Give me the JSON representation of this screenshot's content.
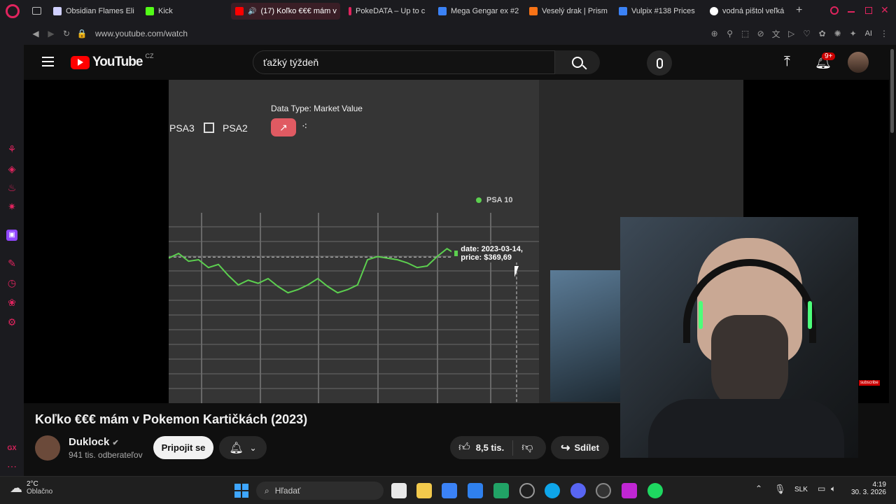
{
  "browser": {
    "tabs": [
      {
        "label": "Obsidian Flames Elit",
        "color": "#6a5acd"
      },
      {
        "label": "Kick",
        "color": "#53fc18"
      },
      {
        "label": "(17) Koľko €€€ mám v",
        "color": "#ff0000",
        "active": true
      },
      {
        "label": "PokeDATA – Up to c",
        "color": "#e0245e"
      },
      {
        "label": "Mega Gengar ex #2",
        "color": "#3b82f6"
      },
      {
        "label": "Veselý drak | Prism",
        "color": "#f97316"
      },
      {
        "label": "Vulpix #138 Prices",
        "color": "#3b82f6"
      },
      {
        "label": "vodná pištol veľká",
        "color": "#4285f4"
      }
    ],
    "url": "www.youtube.com/watch",
    "ai_label": "AI"
  },
  "youtube": {
    "logo_text": "YouTube",
    "logo_region": "CZ",
    "search_query": "ťažký týždeň",
    "notification_badge": "9+"
  },
  "chart_overlay": {
    "data_type_label": "Data Type: Market Value",
    "psa3_label": "PSA3",
    "psa2_label": "PSA2",
    "legend_label": "PSA 10",
    "tooltip": "date: 2023-03-14, price: $369,69"
  },
  "chart_data": {
    "type": "line",
    "series": [
      {
        "name": "PSA 10",
        "color": "#5ccf4f",
        "values": [
          369,
          372,
          367,
          368,
          363,
          365,
          358,
          352,
          355,
          353,
          356,
          351,
          347,
          349,
          352,
          356,
          351,
          347,
          349,
          352,
          368,
          370,
          369,
          368,
          366,
          363,
          364,
          370,
          375,
          371,
          373,
          367,
          368,
          370,
          369,
          369.69
        ]
      }
    ],
    "xlabel": "",
    "ylabel": "",
    "grid": true,
    "legend_position": "top-right"
  },
  "video": {
    "title": "Koľko €€€ mám v Pokemon Kartičkách (2023)",
    "channel_name": "Duklock",
    "subscribers": "941 tis. odberateľov",
    "join_label": "Pripojit se",
    "likes": "8,5 tis.",
    "share_label": "Sdílet",
    "subscribe_overlay": "subscribe"
  },
  "taskbar": {
    "weather_temp": "2°C",
    "weather_desc": "Oblačno",
    "search_placeholder": "Hľadať",
    "language": "SLK",
    "time": "4:19",
    "date": "30. 3. 2026"
  },
  "sidebar_labels": {
    "gx": "GX"
  }
}
